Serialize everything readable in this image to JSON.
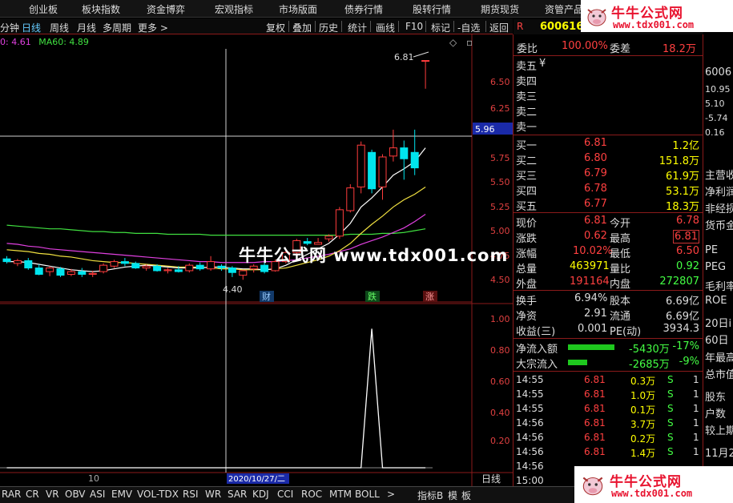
{
  "topnav": {
    "items": [
      "创业板",
      "板块指数",
      "资金博弈",
      "宏观指标",
      "市场版面",
      "债券行情",
      "股转行情",
      "期货现货",
      "资管产品"
    ]
  },
  "logo": {
    "title": "牛牛公式网",
    "url": "www.tdx001.com"
  },
  "toolbar": {
    "periods": [
      "分钟",
      "日线",
      "周线",
      "月线",
      "多周期",
      "更多 >"
    ],
    "buttons": [
      "复权",
      "叠加",
      "历史",
      "统计",
      "画线",
      "F10",
      "标记",
      "-自选",
      "返回"
    ]
  },
  "ma_legend": {
    "ma_a": "0: 4.61",
    "ma60": "MA60: 4.89"
  },
  "chart": {
    "price_ticks": [
      "6.50",
      "6.25",
      "6.00",
      "5.75",
      "5.50",
      "5.25",
      "5.00",
      "4.75",
      "4.50"
    ],
    "current_price_tag": "5.96",
    "high_label": "6.81",
    "low_label": "4.40",
    "markers": [
      "财",
      "跌",
      "涨"
    ],
    "indicator_ticks": [
      "1.00",
      "0.80",
      "0.60",
      "0.40",
      "0.20"
    ],
    "x_label": "10",
    "date_label": "2020/10/27/二",
    "period_label": "日线"
  },
  "chart_data": {
    "type": "candlestick",
    "ylim": [
      4.35,
      6.85
    ],
    "candles": [
      {
        "o": 4.63,
        "h": 4.66,
        "l": 4.58,
        "c": 4.6
      },
      {
        "o": 4.58,
        "h": 4.63,
        "l": 4.55,
        "c": 4.61
      },
      {
        "o": 4.61,
        "h": 4.64,
        "l": 4.51,
        "c": 4.53
      },
      {
        "o": 4.53,
        "h": 4.57,
        "l": 4.45,
        "c": 4.46
      },
      {
        "o": 4.49,
        "h": 4.55,
        "l": 4.44,
        "c": 4.53
      },
      {
        "o": 4.52,
        "h": 4.54,
        "l": 4.43,
        "c": 4.45
      },
      {
        "o": 4.46,
        "h": 4.52,
        "l": 4.44,
        "c": 4.49
      },
      {
        "o": 4.49,
        "h": 4.53,
        "l": 4.43,
        "c": 4.46
      },
      {
        "o": 4.46,
        "h": 4.5,
        "l": 4.43,
        "c": 4.47
      },
      {
        "o": 4.49,
        "h": 4.58,
        "l": 4.47,
        "c": 4.56
      },
      {
        "o": 4.55,
        "h": 4.62,
        "l": 4.53,
        "c": 4.6
      },
      {
        "o": 4.6,
        "h": 4.64,
        "l": 4.55,
        "c": 4.58
      },
      {
        "o": 4.58,
        "h": 4.6,
        "l": 4.52,
        "c": 4.53
      },
      {
        "o": 4.53,
        "h": 4.57,
        "l": 4.5,
        "c": 4.55
      },
      {
        "o": 4.55,
        "h": 4.57,
        "l": 4.49,
        "c": 4.5
      },
      {
        "o": 4.5,
        "h": 4.53,
        "l": 4.47,
        "c": 4.51
      },
      {
        "o": 4.51,
        "h": 4.55,
        "l": 4.48,
        "c": 4.49
      },
      {
        "o": 4.5,
        "h": 4.58,
        "l": 4.48,
        "c": 4.56
      },
      {
        "o": 4.56,
        "h": 4.59,
        "l": 4.5,
        "c": 4.52
      },
      {
        "o": 4.52,
        "h": 4.66,
        "l": 4.5,
        "c": 4.6
      },
      {
        "o": 4.55,
        "h": 4.57,
        "l": 4.5,
        "c": 4.53
      },
      {
        "o": 4.53,
        "h": 4.55,
        "l": 4.43,
        "c": 4.48
      },
      {
        "o": 4.45,
        "h": 4.51,
        "l": 4.4,
        "c": 4.5
      },
      {
        "o": 4.52,
        "h": 4.57,
        "l": 4.48,
        "c": 4.55
      },
      {
        "o": 4.56,
        "h": 4.6,
        "l": 4.47,
        "c": 4.49
      },
      {
        "o": 4.5,
        "h": 4.62,
        "l": 4.49,
        "c": 4.6
      },
      {
        "o": 4.6,
        "h": 4.72,
        "l": 4.58,
        "c": 4.7
      },
      {
        "o": 4.7,
        "h": 4.85,
        "l": 4.68,
        "c": 4.83
      },
      {
        "o": 4.82,
        "h": 4.86,
        "l": 4.78,
        "c": 4.8
      },
      {
        "o": 4.79,
        "h": 4.86,
        "l": 4.79,
        "c": 4.81
      },
      {
        "o": 4.85,
        "h": 4.9,
        "l": 4.82,
        "c": 4.88
      },
      {
        "o": 4.88,
        "h": 5.2,
        "l": 4.85,
        "c": 5.17
      },
      {
        "o": 5.16,
        "h": 5.45,
        "l": 5.14,
        "c": 5.41
      },
      {
        "o": 5.42,
        "h": 5.92,
        "l": 5.35,
        "c": 5.88
      },
      {
        "o": 5.8,
        "h": 5.83,
        "l": 5.35,
        "c": 5.4
      },
      {
        "o": 5.42,
        "h": 5.78,
        "l": 5.28,
        "c": 5.75
      },
      {
        "o": 5.76,
        "h": 6.05,
        "l": 5.7,
        "c": 5.85
      },
      {
        "o": 5.85,
        "h": 5.93,
        "l": 5.5,
        "c": 5.73
      },
      {
        "o": 5.8,
        "h": 6.05,
        "l": 5.55,
        "c": 5.63
      },
      {
        "o": 6.81,
        "h": 6.81,
        "l": 6.5,
        "c": 6.81
      }
    ],
    "ma_short": [
      4.6,
      4.6,
      4.59,
      4.57,
      4.55,
      4.53,
      4.51,
      4.5,
      4.49,
      4.5,
      4.52,
      4.54,
      4.55,
      4.56,
      4.55,
      4.54,
      4.53,
      4.53,
      4.53,
      4.54,
      4.54,
      4.53,
      4.52,
      4.52,
      4.51,
      4.52,
      4.56,
      4.62,
      4.68,
      4.74,
      4.8,
      4.9,
      5.02,
      5.2,
      5.3,
      5.42,
      5.55,
      5.62,
      5.7,
      5.85
    ],
    "ma_mid": [
      4.73,
      4.72,
      4.71,
      4.69,
      4.68,
      4.66,
      4.65,
      4.63,
      4.61,
      4.6,
      4.59,
      4.59,
      4.58,
      4.57,
      4.56,
      4.55,
      4.54,
      4.54,
      4.54,
      4.53,
      4.52,
      4.52,
      4.51,
      4.51,
      4.51,
      4.52,
      4.53,
      4.56,
      4.59,
      4.62,
      4.66,
      4.72,
      4.8,
      4.91,
      5.01,
      5.1,
      5.2,
      5.28,
      5.34,
      5.42
    ],
    "ma_long": [
      4.8,
      4.79,
      4.77,
      4.76,
      4.74,
      4.73,
      4.72,
      4.71,
      4.7,
      4.69,
      4.68,
      4.67,
      4.66,
      4.65,
      4.64,
      4.63,
      4.62,
      4.61,
      4.6,
      4.6,
      4.59,
      4.59,
      4.59,
      4.59,
      4.6,
      4.6,
      4.61,
      4.62,
      4.64,
      4.66,
      4.68,
      4.71,
      4.74,
      4.79,
      4.83,
      4.87,
      4.92,
      4.97,
      5.04,
      5.12
    ],
    "ma60": [
      5.0,
      4.99,
      4.98,
      4.97,
      4.96,
      4.96,
      4.95,
      4.94,
      4.93,
      4.93,
      4.92,
      4.92,
      4.91,
      4.91,
      4.91,
      4.9,
      4.9,
      4.9,
      4.9,
      4.89,
      4.89,
      4.89,
      4.89,
      4.89,
      4.89,
      4.89,
      4.89,
      4.89,
      4.89,
      4.89,
      4.89,
      4.89,
      4.9,
      4.9,
      4.9,
      4.91,
      4.91,
      4.92,
      4.94,
      4.96
    ],
    "indicator_ylim": [
      0,
      1.1
    ],
    "indicator": [
      0,
      0,
      0,
      0,
      0,
      0,
      0,
      0,
      0,
      0,
      0,
      0,
      0,
      0,
      0,
      0,
      0,
      0,
      0,
      0,
      0,
      0,
      0,
      0,
      0,
      0,
      0,
      0,
      0,
      0,
      0,
      0,
      0,
      0,
      1.0,
      0,
      0,
      0,
      0,
      0
    ]
  },
  "quote": {
    "code": "600616",
    "weibi_label": "委比",
    "weibi": "100.00%",
    "weicha_label": "委差",
    "weicha": "18.2万",
    "asks": [
      {
        "label": "卖五",
        "price": "¥"
      },
      {
        "label": "卖四",
        "price": ""
      },
      {
        "label": "卖三",
        "price": ""
      },
      {
        "label": "卖二",
        "price": ""
      },
      {
        "label": "卖一",
        "price": ""
      }
    ],
    "bids": [
      {
        "label": "买一",
        "price": "6.81",
        "vol": "1.2亿"
      },
      {
        "label": "买二",
        "price": "6.80",
        "vol": "151.8万"
      },
      {
        "label": "买三",
        "price": "6.79",
        "vol": "61.9万"
      },
      {
        "label": "买四",
        "price": "6.78",
        "vol": "53.1万"
      },
      {
        "label": "买五",
        "price": "6.77",
        "vol": "18.3万"
      }
    ],
    "stats": [
      {
        "l1": "现价",
        "v1": "6.81",
        "l2": "今开",
        "v2": "6.78"
      },
      {
        "l1": "涨跌",
        "v1": "0.62",
        "l2": "最高",
        "v2": "6.81"
      },
      {
        "l1": "涨幅",
        "v1": "10.02%",
        "l2": "最低",
        "v2": "6.50"
      },
      {
        "l1": "总量",
        "v1": "463971",
        "l2": "量比",
        "v2": "0.92"
      },
      {
        "l1": "外盘",
        "v1": "191164",
        "l2": "内盘",
        "v2": "272807"
      }
    ],
    "stats2": [
      {
        "l1": "换手",
        "v1": "6.94%",
        "l2": "股本",
        "v2": "6.69亿"
      },
      {
        "l1": "净资",
        "v1": "2.91",
        "l2": "流通",
        "v2": "6.69亿"
      },
      {
        "l1": "收益(三)",
        "v1": "0.001",
        "l2": "PE(动)",
        "v2": "3934.3"
      }
    ],
    "flows": [
      {
        "label": "净流入额",
        "value": "-5430万",
        "pct": "-17%",
        "bar": 0.58
      },
      {
        "label": "大宗流入",
        "value": "-2685万",
        "pct": "-9%",
        "bar": 0.24
      }
    ],
    "ticks": [
      {
        "time": "14:55",
        "price": "6.81",
        "vol": "0.3万",
        "side": "S",
        "n": "1"
      },
      {
        "time": "14:55",
        "price": "6.81",
        "vol": "1.0万",
        "side": "S",
        "n": "1"
      },
      {
        "time": "14:55",
        "price": "6.81",
        "vol": "0.1万",
        "side": "S",
        "n": "1"
      },
      {
        "time": "14:56",
        "price": "6.81",
        "vol": "3.7万",
        "side": "S",
        "n": "1"
      },
      {
        "time": "14:56",
        "price": "6.81",
        "vol": "0.2万",
        "side": "S",
        "n": "1"
      },
      {
        "time": "14:56",
        "price": "6.81",
        "vol": "1.4万",
        "side": "S",
        "n": "1"
      },
      {
        "time": "14:56",
        "price": "",
        "vol": "",
        "side": "",
        "n": ""
      },
      {
        "time": "15:00",
        "price": "",
        "vol": "",
        "side": "",
        "n": ""
      }
    ]
  },
  "farright": {
    "items": [
      "6006",
      "10.95",
      "5.10",
      "-5.74",
      "0.16",
      "主营收",
      "净利润",
      "非经损",
      "货币金",
      "PE",
      "PEG",
      "毛利率",
      "ROE",
      "20日i",
      "60日",
      "年最高",
      "总市值",
      "股东",
      "户数",
      "较上期",
      "11月2"
    ]
  },
  "bottom_tabs": [
    "RAR",
    "CR",
    "VR",
    "OBV",
    "ASI",
    "EMV",
    "VOL-TDX",
    "RSI",
    "WR",
    "SAR",
    "KDJ",
    "CCI",
    "ROC",
    "MTM",
    "BOLL",
    ">",
    "指标B",
    "模",
    "板"
  ],
  "watermark": "牛牛公式网 www.tdx001.com",
  "colors": {
    "up": "#ff3c3c",
    "down": "#00e5ee",
    "ma_short": "#ffffff",
    "ma_mid": "#f0e040",
    "ma_long": "#e040e0",
    "ma60": "#40e040",
    "grid_frame": "#8b1a1a"
  }
}
